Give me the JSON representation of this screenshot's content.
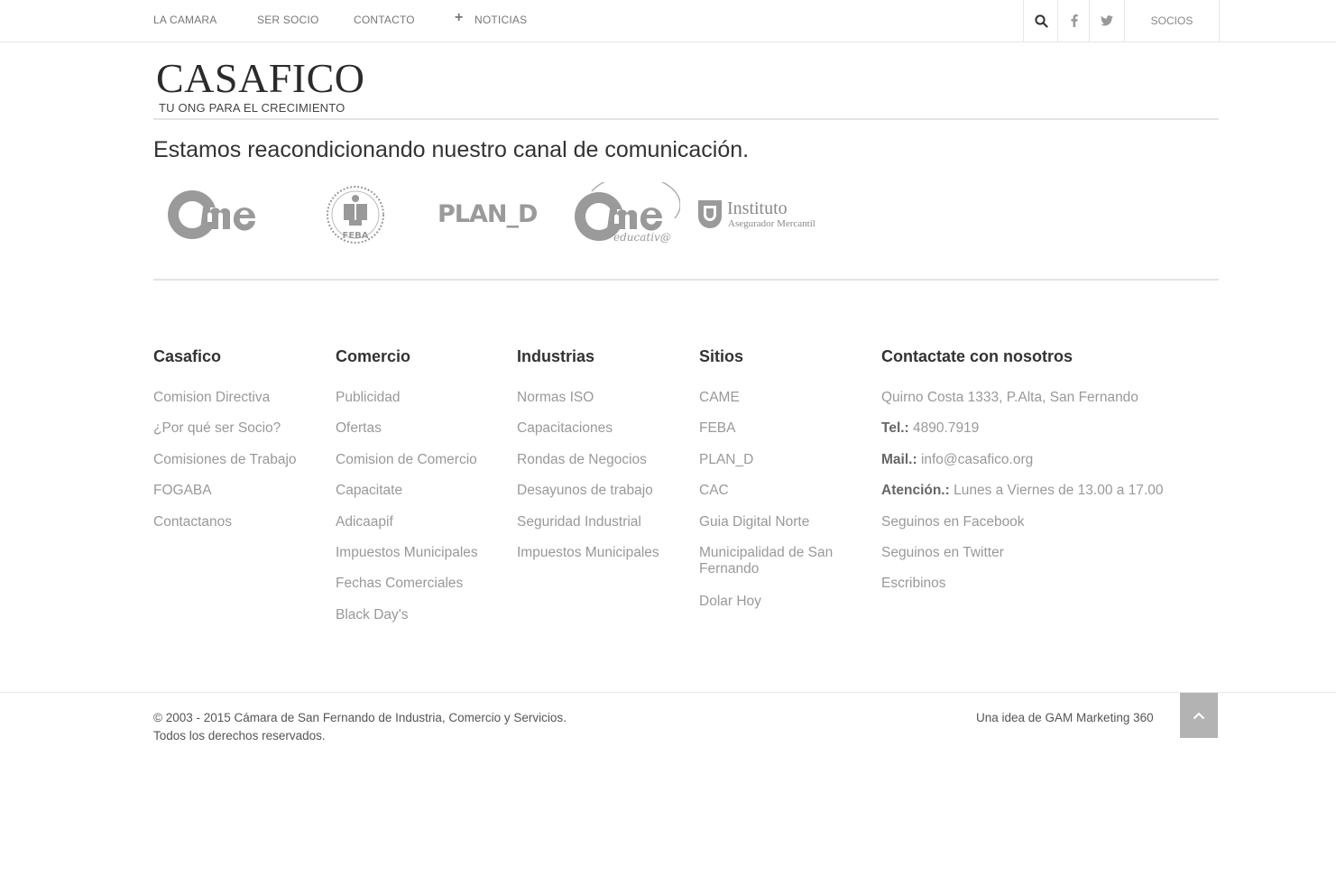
{
  "nav": {
    "items": [
      "LA CAMARA",
      "SER SOCIO",
      "CONTACTO",
      "NOTICIAS"
    ],
    "socios": "SOCIOS"
  },
  "logo": {
    "title": "CASAFICO",
    "subtitle": "TU ONG PARA EL CRECIMIENTO"
  },
  "headline": "Estamos reacondicionando nuestro canal de comunicación.",
  "partners": {
    "feba": "FEBA",
    "pland": "PLAN_D",
    "educativa": "educativ@",
    "instituto_title": "Instituto",
    "instituto_sub": "Asegurador Mercantil"
  },
  "footer": {
    "casafico": {
      "title": "Casafico",
      "items": [
        "Comision Directiva",
        "¿Por qué ser Socio?",
        "Comisiones de Trabajo",
        "FOGABA",
        "Contactanos"
      ]
    },
    "comercio": {
      "title": "Comercio",
      "items": [
        "Publicidad",
        "Ofertas",
        "Comision de Comercio",
        "Capacitate",
        "Adicaapif",
        "Impuestos Municipales",
        "Fechas Comerciales",
        "Black Day's"
      ]
    },
    "industrias": {
      "title": "Industrias",
      "items": [
        "Normas ISO",
        "Capacitaciones",
        "Rondas de Negocios",
        "Desayunos de trabajo",
        "Seguridad Industrial",
        "Impuestos Municipales"
      ]
    },
    "sitios": {
      "title": "Sitios",
      "items": [
        "CAME",
        "FEBA",
        "PLAN_D",
        "CAC",
        "Guia Digital Norte",
        "Municipalidad de San Fernando",
        "Dolar Hoy"
      ]
    },
    "contacto": {
      "title": "Contactate con nosotros",
      "address": "Quirno Costa 1333, P.Alta, San Fernando",
      "tel_label": "Tel.:",
      "tel": "4890.7919",
      "mail_label": "Mail.:",
      "mail": "info@casafico.org",
      "hours_label": "Atención.:",
      "hours": "Lunes a Viernes de 13.00 a 17.00",
      "facebook": "Seguinos en Facebook",
      "twitter": "Seguinos en Twitter",
      "write": "Escribinos"
    }
  },
  "bottom": {
    "copyright": "© 2003 - 2015 Cámara de San Fernando de Industria, Comercio y Servicios.",
    "rights": "Todos los derechos reservados.",
    "credit": "Una idea de GAM Marketing 360"
  },
  "colors": {
    "accent": "#b3b3b3",
    "heading": "#333333",
    "link": "#999999"
  }
}
